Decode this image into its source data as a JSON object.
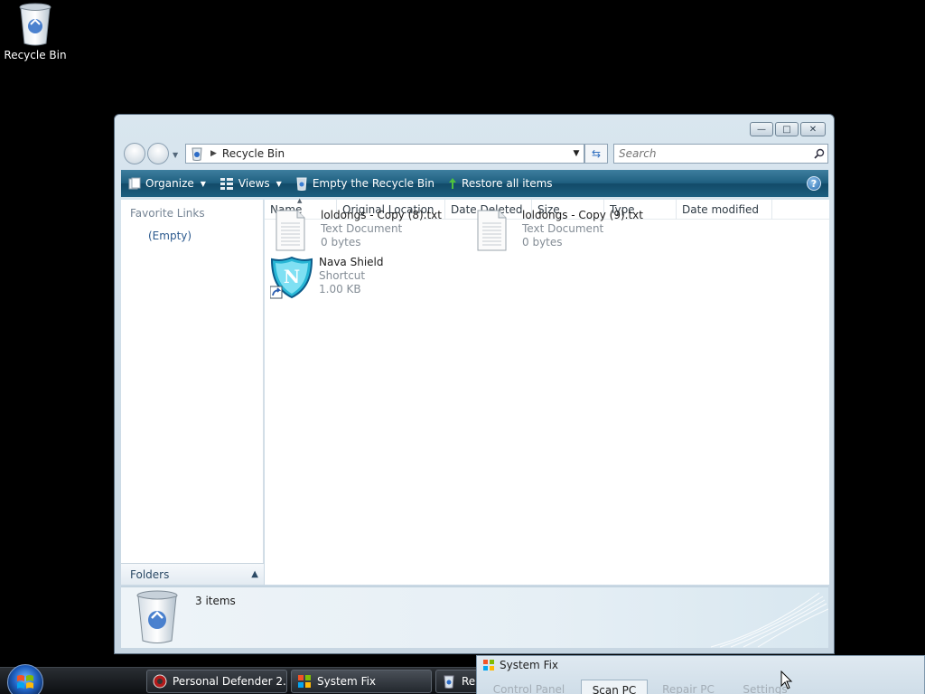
{
  "desktop": {
    "recycle_bin_label": "Recycle Bin"
  },
  "explorer": {
    "caption_buttons": {
      "minimize": "—",
      "maximize": "□",
      "close": "✕"
    },
    "address": {
      "path": "Recycle Bin"
    },
    "search": {
      "placeholder": "Search"
    },
    "toolbar": {
      "organize": "Organize",
      "views": "Views",
      "empty_bin": "Empty the Recycle Bin",
      "restore_all": "Restore all items",
      "help": "?"
    },
    "left_pane": {
      "favorite_links_title": "Favorite Links",
      "favorite_links_empty": "(Empty)",
      "folders_label": "Folders"
    },
    "columns": [
      "Name",
      "Original Location",
      "Date Deleted",
      "Size",
      "Type",
      "Date modified"
    ],
    "files": [
      {
        "name": "loldongs - Copy (8).txt",
        "type": "Text Document",
        "size": "0 bytes",
        "icon": "text-document-icon"
      },
      {
        "name": "loldongs - Copy (9).txt",
        "type": "Text Document",
        "size": "0 bytes",
        "icon": "text-document-icon"
      },
      {
        "name": "Nava Shield",
        "type": "Shortcut",
        "size": "1.00 KB",
        "icon": "nava-shield-icon"
      }
    ],
    "details": {
      "item_count": "3 items"
    }
  },
  "taskbar": {
    "buttons": [
      {
        "label": "Personal Defender 2...",
        "icon": "personal-defender-icon"
      },
      {
        "label": "System Fix",
        "icon": "system-fix-icon"
      },
      {
        "label": "Re",
        "icon": "recycle-bin-icon"
      }
    ]
  },
  "system_fix_window": {
    "title": "System Fix",
    "tabs": [
      "Control Panel",
      "Scan PC",
      "Repair PC",
      "Settings"
    ],
    "active_tab": "Scan PC"
  },
  "colors": {
    "toolbar": "#1f5f80",
    "link": "#2c5a8e",
    "muted_text": "#848d96"
  }
}
